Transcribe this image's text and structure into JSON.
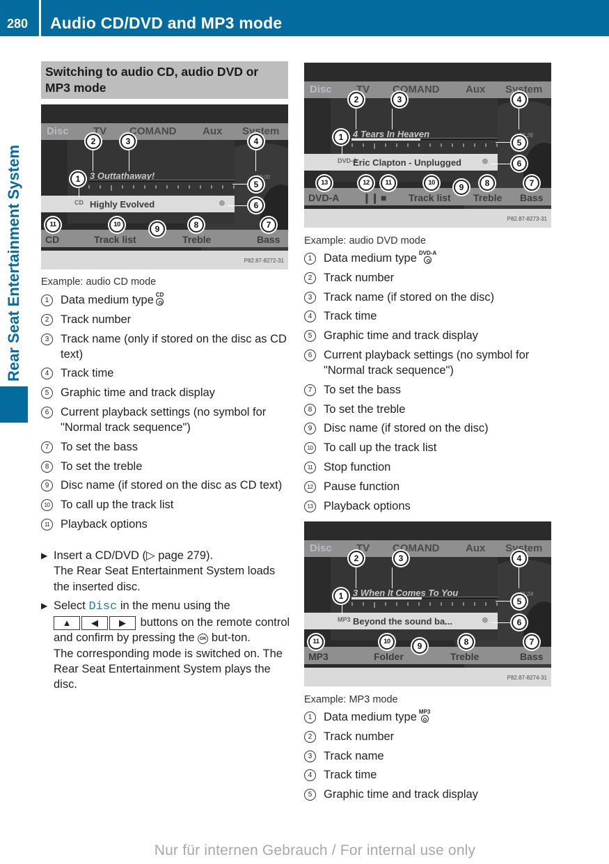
{
  "header": {
    "page_number": "280",
    "chapter_title": "Audio CD/DVD and MP3 mode"
  },
  "side_tab": {
    "title": "Rear Seat Entertainment System"
  },
  "section": {
    "heading": "Switching to audio CD, audio DVD or MP3 mode"
  },
  "figures": {
    "cd": {
      "menu": [
        "Disc",
        "TV",
        "COMAND",
        "Aux",
        "System"
      ],
      "track": "3 Outtathaway!",
      "time": "00:00",
      "progress_fraction": 0.0,
      "disc_name": "Highly Evolved",
      "medium_icon": "CD",
      "softkeys": [
        "CD",
        "Track list",
        "Treble",
        "Bass"
      ],
      "figure_id": "P82.87-8272-31",
      "callouts": [
        "1",
        "2",
        "3",
        "4",
        "5",
        "6",
        "7",
        "8",
        "9",
        "10",
        "11"
      ]
    },
    "dvd": {
      "menu": [
        "Disc",
        "TV",
        "COMAND",
        "Aux",
        "System"
      ],
      "track": "4 Tears In Heaven",
      "time": "01:26",
      "progress_fraction": 0.47,
      "disc_name": "Eric Clapton - Unplugged",
      "medium_icon": "DVD-A",
      "softkeys": [
        "DVD-A",
        "❙❙",
        "■",
        "Track list",
        "Treble",
        "Bass"
      ],
      "figure_id": "P82.87-8273-31",
      "callouts": [
        "1",
        "2",
        "3",
        "4",
        "5",
        "6",
        "7",
        "8",
        "9",
        "10",
        "11",
        "12",
        "13"
      ]
    },
    "mp3": {
      "menu": [
        "Disc",
        "TV",
        "COMAND",
        "Aux",
        "System"
      ],
      "track": "3 When It Comes To You",
      "time": "01:24",
      "progress_fraction": 0.48,
      "disc_name": "Beyond the sound ba...",
      "medium_icon": "MP3",
      "softkeys": [
        "MP3",
        "Folder",
        "Treble",
        "Bass"
      ],
      "figure_id": "P82.87-8274-31",
      "callouts": [
        "1",
        "2",
        "3",
        "4",
        "5",
        "6",
        "7",
        "8",
        "9",
        "10",
        "11"
      ]
    }
  },
  "cd_legend": {
    "caption": "Example: audio CD mode",
    "items": [
      {
        "num": "1",
        "text": "Data medium type",
        "icon": "CD"
      },
      {
        "num": "2",
        "text": "Track number"
      },
      {
        "num": "3",
        "text": "Track name (only if stored on the disc as CD text)"
      },
      {
        "num": "4",
        "text": "Track time"
      },
      {
        "num": "5",
        "text": "Graphic time and track display"
      },
      {
        "num": "6",
        "text": "Current playback settings (no symbol for \"Normal track sequence\")"
      },
      {
        "num": "7",
        "text": "To set the bass"
      },
      {
        "num": "8",
        "text": "To set the treble"
      },
      {
        "num": "9",
        "text": "Disc name (if stored on the disc as CD text)"
      },
      {
        "num": "10",
        "text": "To call up the track list"
      },
      {
        "num": "11",
        "text": "Playback options"
      }
    ]
  },
  "steps": [
    {
      "text": "Insert a CD/DVD (▷ page 279).",
      "result": "The Rear Seat Entertainment System loads the inserted disc."
    },
    {
      "pre": "Select",
      "keyword": "Disc",
      "mid": "in the menu using the",
      "keys": [
        "▲",
        "◀",
        "▶"
      ],
      "post": "buttons on the remote control and confirm by pressing the",
      "ok_label": "OK",
      "post2": "but-ton.",
      "result": "The corresponding mode is switched on. The Rear Seat Entertainment System plays the disc."
    }
  ],
  "dvd_legend": {
    "caption": "Example: audio DVD mode",
    "items": [
      {
        "num": "1",
        "text": "Data medium type",
        "icon": "DVD-A"
      },
      {
        "num": "2",
        "text": "Track number"
      },
      {
        "num": "3",
        "text": "Track name (if stored on the disc)"
      },
      {
        "num": "4",
        "text": "Track time"
      },
      {
        "num": "5",
        "text": "Graphic time and track display"
      },
      {
        "num": "6",
        "text": "Current playback settings (no symbol for \"Normal track sequence\")"
      },
      {
        "num": "7",
        "text": "To set the bass"
      },
      {
        "num": "8",
        "text": "To set the treble"
      },
      {
        "num": "9",
        "text": "Disc name (if stored on the disc)"
      },
      {
        "num": "10",
        "text": "To call up the track list"
      },
      {
        "num": "11",
        "text": "Stop function"
      },
      {
        "num": "12",
        "text": "Pause function"
      },
      {
        "num": "13",
        "text": "Playback options"
      }
    ]
  },
  "mp3_legend": {
    "caption": "Example: MP3 mode",
    "items": [
      {
        "num": "1",
        "text": "Data medium type",
        "icon": "MP3"
      },
      {
        "num": "2",
        "text": "Track number"
      },
      {
        "num": "3",
        "text": "Track name"
      },
      {
        "num": "4",
        "text": "Track time"
      },
      {
        "num": "5",
        "text": "Graphic time and track display"
      }
    ]
  },
  "watermark": "Nur für internen Gebrauch / For internal use only",
  "colors": {
    "brand_blue": "#036b9e",
    "heading_gray": "#bdbdbd",
    "keyword_blue": "#1d7cb5"
  }
}
